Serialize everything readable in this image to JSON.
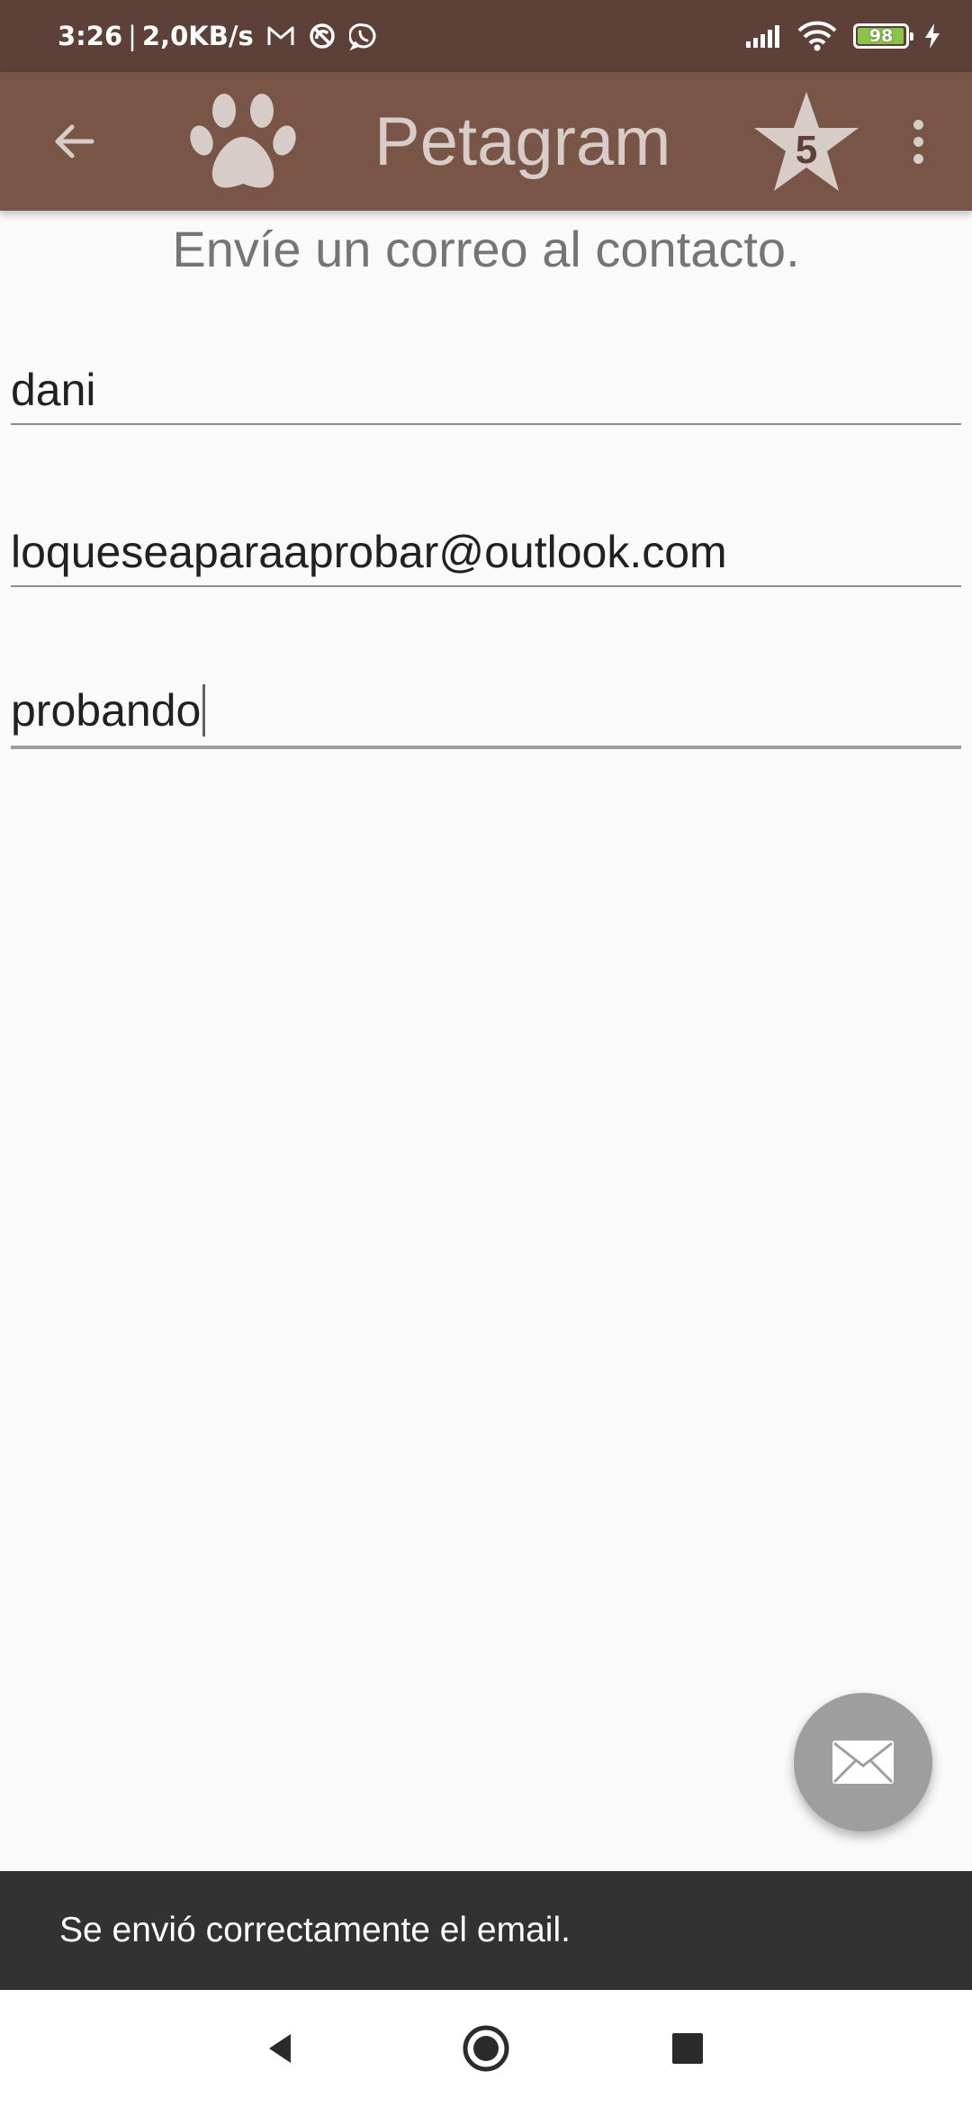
{
  "status_bar": {
    "time": "3:26",
    "separator": "|",
    "network_speed": "2,0KB/s",
    "notification_icons": [
      "gmail-icon",
      "vpn-icon",
      "whatsapp-icon"
    ],
    "system_icons": [
      "signal-icon",
      "wifi-icon",
      "battery-icon",
      "charging-icon"
    ],
    "battery_level": "98",
    "battery_fraction": 0.98
  },
  "app_bar": {
    "title": "Petagram",
    "back_icon": "arrow-back-icon",
    "logo_icon": "paw-icon",
    "star_count": "5",
    "menu_icon": "more-vert-icon"
  },
  "form": {
    "heading": "Envíe un correo al contacto.",
    "name_value": "dani",
    "email_value": "loqueseaparaaprobar@outlook.com",
    "message_value": "probando"
  },
  "fab": {
    "icon": "email-icon"
  },
  "snackbar": {
    "message": "Se envió correctamente el email."
  },
  "nav_bar": {
    "buttons": [
      "back-triangle-icon",
      "home-circle-icon",
      "recents-square-icon"
    ]
  },
  "colors": {
    "status_bar": "#5d4037",
    "app_bar": "#795548",
    "app_bar_foreground": "#d7ccc8",
    "background": "#fafafa",
    "snackbar": "#323232",
    "fab": "#9e9e9e"
  }
}
